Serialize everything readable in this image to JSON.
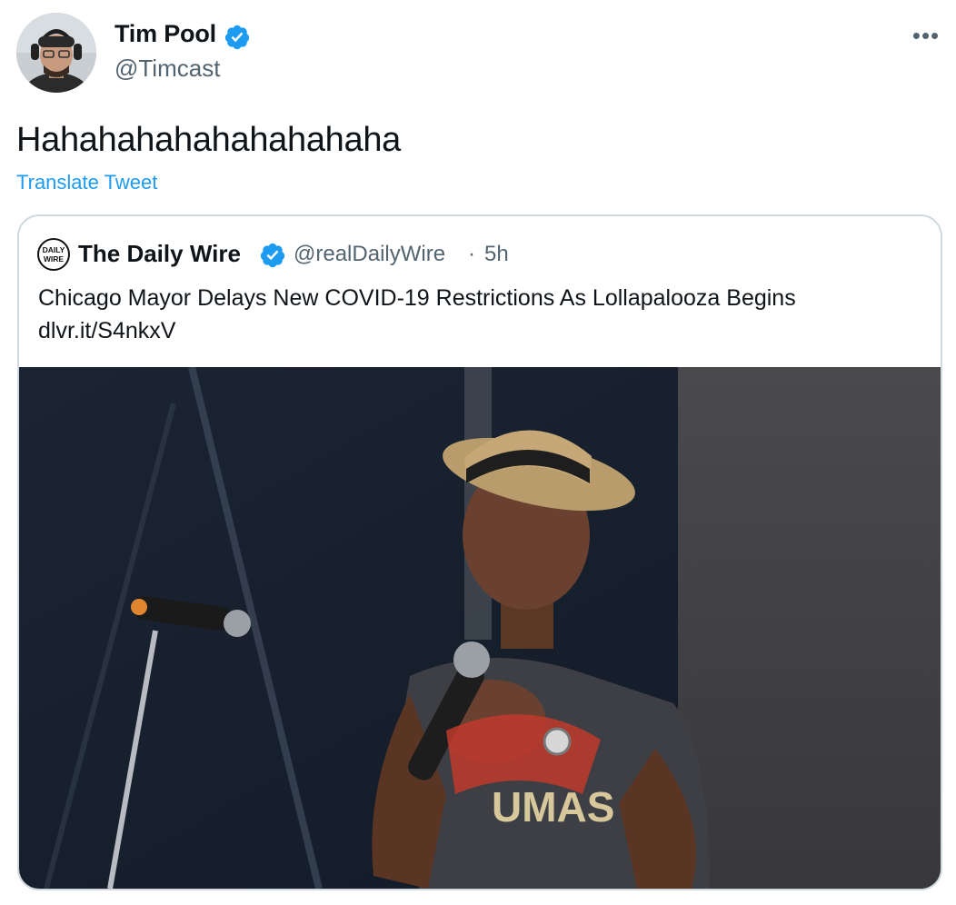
{
  "tweet": {
    "author_name": "Tim Pool",
    "author_handle": "@Timcast",
    "text": "Hahahahahahahahahaha",
    "translate_label": "Translate Tweet",
    "more_label": "•••"
  },
  "quoted": {
    "author_name": "The Daily Wire",
    "author_handle": "@realDailyWire",
    "separator": "·",
    "time": "5h",
    "text": "Chicago Mayor Delays New COVID-19 Restrictions As Lollapalooza Begins",
    "link": "dlvr.it/S4nkxV",
    "avatar_text_line1": "DAILY",
    "avatar_text_line2": "WIRE"
  },
  "colors": {
    "verified": "#1d9bf0",
    "link": "#1d9bf0",
    "secondary_text": "#536471",
    "border": "#cfd9de"
  },
  "icons": {
    "verified": "verified-badge-icon",
    "more": "more-options-icon"
  }
}
